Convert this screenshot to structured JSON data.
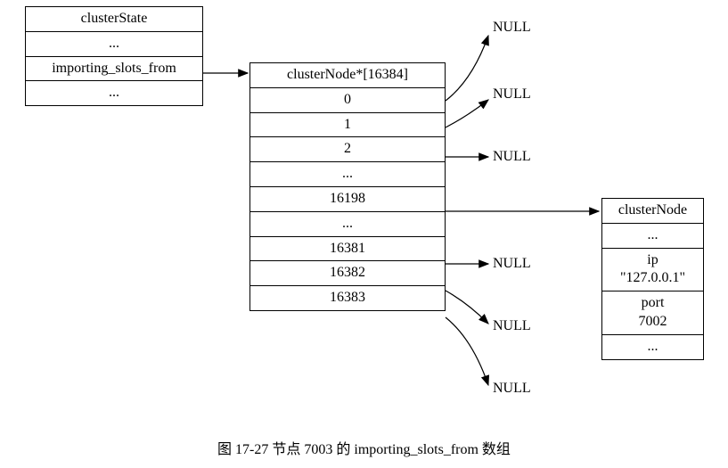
{
  "clusterState": {
    "header": "clusterState",
    "rows": [
      "...",
      "importing_slots_from",
      "..."
    ]
  },
  "array": {
    "header": "clusterNode*[16384]",
    "rows": [
      "0",
      "1",
      "2",
      "...",
      "16198",
      "...",
      "16381",
      "16382",
      "16383"
    ]
  },
  "nulls": {
    "n0": "NULL",
    "n1": "NULL",
    "n2": "NULL",
    "n16381": "NULL",
    "n16382": "NULL",
    "n16383": "NULL"
  },
  "clusterNode": {
    "header": "clusterNode",
    "rows": [
      "...",
      "ip\n\"127.0.0.1\"",
      "port\n7002",
      "..."
    ]
  },
  "caption": "图 17-27    节点 7003 的 importing_slots_from 数组"
}
